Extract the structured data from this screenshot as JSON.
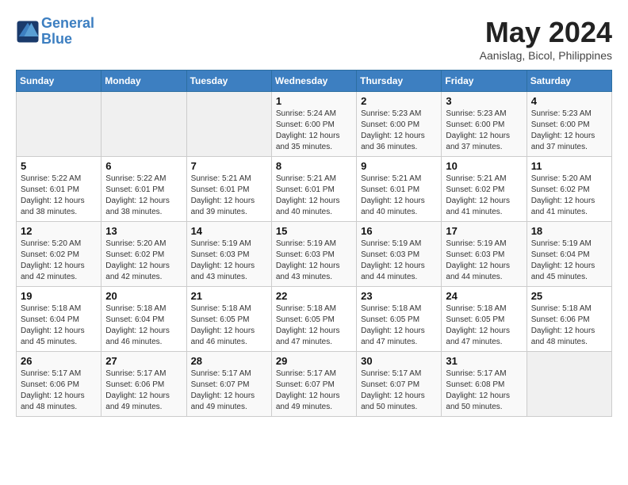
{
  "header": {
    "logo_line1": "General",
    "logo_line2": "Blue",
    "month_title": "May 2024",
    "location": "Aanislag, Bicol, Philippines"
  },
  "weekdays": [
    "Sunday",
    "Monday",
    "Tuesday",
    "Wednesday",
    "Thursday",
    "Friday",
    "Saturday"
  ],
  "weeks": [
    [
      {
        "day": "",
        "sunrise": "",
        "sunset": "",
        "daylight": ""
      },
      {
        "day": "",
        "sunrise": "",
        "sunset": "",
        "daylight": ""
      },
      {
        "day": "",
        "sunrise": "",
        "sunset": "",
        "daylight": ""
      },
      {
        "day": "1",
        "sunrise": "Sunrise: 5:24 AM",
        "sunset": "Sunset: 6:00 PM",
        "daylight": "Daylight: 12 hours and 35 minutes."
      },
      {
        "day": "2",
        "sunrise": "Sunrise: 5:23 AM",
        "sunset": "Sunset: 6:00 PM",
        "daylight": "Daylight: 12 hours and 36 minutes."
      },
      {
        "day": "3",
        "sunrise": "Sunrise: 5:23 AM",
        "sunset": "Sunset: 6:00 PM",
        "daylight": "Daylight: 12 hours and 37 minutes."
      },
      {
        "day": "4",
        "sunrise": "Sunrise: 5:23 AM",
        "sunset": "Sunset: 6:00 PM",
        "daylight": "Daylight: 12 hours and 37 minutes."
      }
    ],
    [
      {
        "day": "5",
        "sunrise": "Sunrise: 5:22 AM",
        "sunset": "Sunset: 6:01 PM",
        "daylight": "Daylight: 12 hours and 38 minutes."
      },
      {
        "day": "6",
        "sunrise": "Sunrise: 5:22 AM",
        "sunset": "Sunset: 6:01 PM",
        "daylight": "Daylight: 12 hours and 38 minutes."
      },
      {
        "day": "7",
        "sunrise": "Sunrise: 5:21 AM",
        "sunset": "Sunset: 6:01 PM",
        "daylight": "Daylight: 12 hours and 39 minutes."
      },
      {
        "day": "8",
        "sunrise": "Sunrise: 5:21 AM",
        "sunset": "Sunset: 6:01 PM",
        "daylight": "Daylight: 12 hours and 40 minutes."
      },
      {
        "day": "9",
        "sunrise": "Sunrise: 5:21 AM",
        "sunset": "Sunset: 6:01 PM",
        "daylight": "Daylight: 12 hours and 40 minutes."
      },
      {
        "day": "10",
        "sunrise": "Sunrise: 5:21 AM",
        "sunset": "Sunset: 6:02 PM",
        "daylight": "Daylight: 12 hours and 41 minutes."
      },
      {
        "day": "11",
        "sunrise": "Sunrise: 5:20 AM",
        "sunset": "Sunset: 6:02 PM",
        "daylight": "Daylight: 12 hours and 41 minutes."
      }
    ],
    [
      {
        "day": "12",
        "sunrise": "Sunrise: 5:20 AM",
        "sunset": "Sunset: 6:02 PM",
        "daylight": "Daylight: 12 hours and 42 minutes."
      },
      {
        "day": "13",
        "sunrise": "Sunrise: 5:20 AM",
        "sunset": "Sunset: 6:02 PM",
        "daylight": "Daylight: 12 hours and 42 minutes."
      },
      {
        "day": "14",
        "sunrise": "Sunrise: 5:19 AM",
        "sunset": "Sunset: 6:03 PM",
        "daylight": "Daylight: 12 hours and 43 minutes."
      },
      {
        "day": "15",
        "sunrise": "Sunrise: 5:19 AM",
        "sunset": "Sunset: 6:03 PM",
        "daylight": "Daylight: 12 hours and 43 minutes."
      },
      {
        "day": "16",
        "sunrise": "Sunrise: 5:19 AM",
        "sunset": "Sunset: 6:03 PM",
        "daylight": "Daylight: 12 hours and 44 minutes."
      },
      {
        "day": "17",
        "sunrise": "Sunrise: 5:19 AM",
        "sunset": "Sunset: 6:03 PM",
        "daylight": "Daylight: 12 hours and 44 minutes."
      },
      {
        "day": "18",
        "sunrise": "Sunrise: 5:19 AM",
        "sunset": "Sunset: 6:04 PM",
        "daylight": "Daylight: 12 hours and 45 minutes."
      }
    ],
    [
      {
        "day": "19",
        "sunrise": "Sunrise: 5:18 AM",
        "sunset": "Sunset: 6:04 PM",
        "daylight": "Daylight: 12 hours and 45 minutes."
      },
      {
        "day": "20",
        "sunrise": "Sunrise: 5:18 AM",
        "sunset": "Sunset: 6:04 PM",
        "daylight": "Daylight: 12 hours and 46 minutes."
      },
      {
        "day": "21",
        "sunrise": "Sunrise: 5:18 AM",
        "sunset": "Sunset: 6:05 PM",
        "daylight": "Daylight: 12 hours and 46 minutes."
      },
      {
        "day": "22",
        "sunrise": "Sunrise: 5:18 AM",
        "sunset": "Sunset: 6:05 PM",
        "daylight": "Daylight: 12 hours and 47 minutes."
      },
      {
        "day": "23",
        "sunrise": "Sunrise: 5:18 AM",
        "sunset": "Sunset: 6:05 PM",
        "daylight": "Daylight: 12 hours and 47 minutes."
      },
      {
        "day": "24",
        "sunrise": "Sunrise: 5:18 AM",
        "sunset": "Sunset: 6:05 PM",
        "daylight": "Daylight: 12 hours and 47 minutes."
      },
      {
        "day": "25",
        "sunrise": "Sunrise: 5:18 AM",
        "sunset": "Sunset: 6:06 PM",
        "daylight": "Daylight: 12 hours and 48 minutes."
      }
    ],
    [
      {
        "day": "26",
        "sunrise": "Sunrise: 5:17 AM",
        "sunset": "Sunset: 6:06 PM",
        "daylight": "Daylight: 12 hours and 48 minutes."
      },
      {
        "day": "27",
        "sunrise": "Sunrise: 5:17 AM",
        "sunset": "Sunset: 6:06 PM",
        "daylight": "Daylight: 12 hours and 49 minutes."
      },
      {
        "day": "28",
        "sunrise": "Sunrise: 5:17 AM",
        "sunset": "Sunset: 6:07 PM",
        "daylight": "Daylight: 12 hours and 49 minutes."
      },
      {
        "day": "29",
        "sunrise": "Sunrise: 5:17 AM",
        "sunset": "Sunset: 6:07 PM",
        "daylight": "Daylight: 12 hours and 49 minutes."
      },
      {
        "day": "30",
        "sunrise": "Sunrise: 5:17 AM",
        "sunset": "Sunset: 6:07 PM",
        "daylight": "Daylight: 12 hours and 50 minutes."
      },
      {
        "day": "31",
        "sunrise": "Sunrise: 5:17 AM",
        "sunset": "Sunset: 6:08 PM",
        "daylight": "Daylight: 12 hours and 50 minutes."
      },
      {
        "day": "",
        "sunrise": "",
        "sunset": "",
        "daylight": ""
      }
    ]
  ]
}
